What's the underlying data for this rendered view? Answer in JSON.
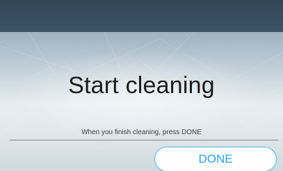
{
  "screen": {
    "title": "Start cleaning",
    "hint": "When you finish cleaning, press DONE",
    "done_label": "DONE"
  },
  "colors": {
    "top_bar": "#324657",
    "button_text": "#2f9fe0",
    "button_border": "#4fb6e6"
  }
}
